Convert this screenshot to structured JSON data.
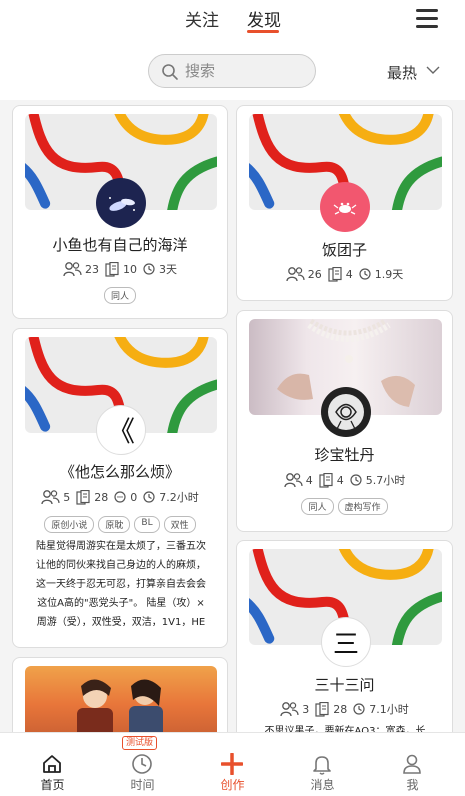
{
  "header": {
    "tabs": [
      {
        "label": "关注"
      },
      {
        "label": "发现"
      }
    ],
    "active_tab": "发现",
    "search_placeholder": "搜索",
    "sort_label": "最热"
  },
  "cards": [
    {
      "title": "小鱼也有自己的海洋",
      "members": "23",
      "posts": "10",
      "time": "3天",
      "tags": [
        "同人"
      ]
    },
    {
      "title": "饭团子",
      "members": "26",
      "posts": "4",
      "time": "1.9天",
      "tags": []
    },
    {
      "title": "《他怎么那么烦》",
      "avatar_glyph": "《",
      "members": "5",
      "posts": "28",
      "comments": "0",
      "time": "7.2小时",
      "tags": [
        "原创小说",
        "原耽",
        "BL",
        "双性"
      ],
      "description": "陆星觉得周游实在是太烦了，三番五次让他的同伙来找自己身边的人的麻烦，这一天终于忍无可忍，打算亲自去会会这位A高的\"恶党头子\"。 陆星（攻）×周游（受），双性受，双洁，1V1，HE"
    },
    {
      "title": "珍宝牡丹",
      "members": "4",
      "posts": "4",
      "time": "5.7小时",
      "tags": [
        "同人",
        "虚构写作"
      ]
    },
    {
      "title": "三十三问",
      "avatar_glyph": "三",
      "members": "3",
      "posts": "28",
      "time": "7.1小时",
      "tags": [],
      "description_partial": "不思议黑子，要新在AO3：宽森，长"
    }
  ],
  "bottom_nav": {
    "items": [
      {
        "label": "首页",
        "icon": "home-icon"
      },
      {
        "label": "时间",
        "icon": "clock-icon"
      },
      {
        "label": "创作",
        "icon": "plus-icon"
      },
      {
        "label": "消息",
        "icon": "bell-icon"
      },
      {
        "label": "我",
        "icon": "person-icon"
      }
    ],
    "beta_badge": "测试版"
  },
  "colors": {
    "accent": "#e8502c",
    "stripe_red": "#e0211b",
    "stripe_yellow": "#f6ae12",
    "stripe_green": "#2f9a3e",
    "stripe_blue": "#2b67c6"
  }
}
